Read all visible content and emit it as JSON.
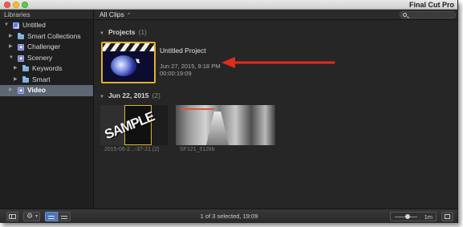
{
  "window": {
    "app_title": "Final Cut Pro"
  },
  "sidebar": {
    "header": "Libraries",
    "items": [
      {
        "label": "Untitled",
        "disclosure": "▼",
        "icon": "library-icon"
      },
      {
        "label": "Smart Collections",
        "disclosure": "▶",
        "icon": "folder-icon"
      },
      {
        "label": "Challenger",
        "disclosure": "▶",
        "icon": "event-icon"
      },
      {
        "label": "Scenery",
        "disclosure": "▼",
        "icon": "event-icon"
      },
      {
        "label": "Keywords",
        "disclosure": "▶",
        "icon": "folder-icon"
      },
      {
        "label": "Smart",
        "disclosure": "▶",
        "icon": "folder-icon"
      },
      {
        "label": "Video",
        "disclosure": "▶",
        "icon": "event-icon",
        "selected": true
      }
    ]
  },
  "browser": {
    "filter_label": "All Clips",
    "filter_caret": "⌃",
    "projects_section": {
      "triangle": "▼",
      "title": "Projects",
      "count": "(1)"
    },
    "project": {
      "name": "Untitled Project",
      "date": "Jun 27, 2015, 9:18 PM",
      "duration": "00:00:19:09"
    },
    "date_section": {
      "triangle": "▼",
      "title": "Jun 22, 2015",
      "count": "(2)"
    },
    "clips": [
      {
        "overlay_text": "SAMPLE",
        "label": "2015-06-2...-37-21 (2)"
      },
      {
        "label": "SF121_512kb"
      }
    ]
  },
  "toolbar": {
    "status": "1 of 3 selected, 19:09",
    "zoom_label": "1m",
    "gear_caret": "▾"
  },
  "colors": {
    "selection_highlight": "#5d6774",
    "project_border": "#e0b12f",
    "annotation_arrow": "#e02c1c",
    "active_view_button": "#4f75b6"
  }
}
